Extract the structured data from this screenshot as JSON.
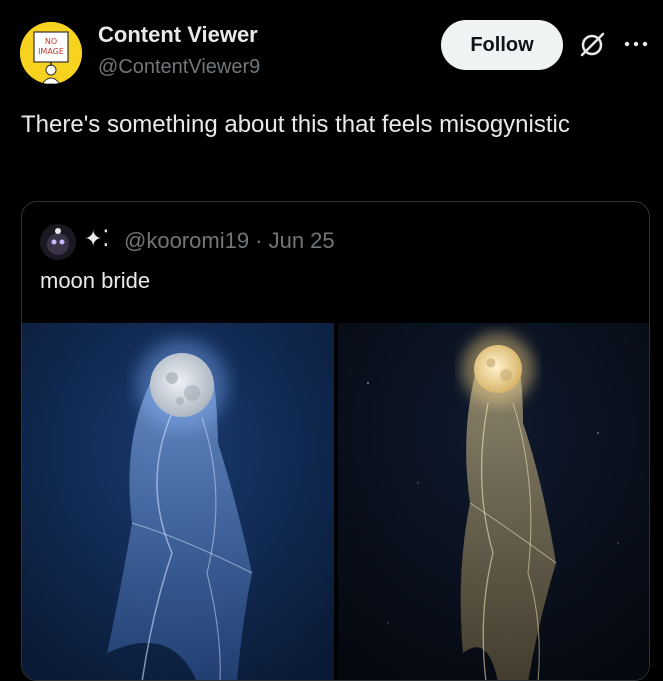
{
  "post": {
    "author": {
      "name": "Content Viewer",
      "handle": "@ContentViewer9"
    },
    "avatar": {
      "sign_line1": "NO",
      "sign_line2": "IMAGE",
      "bg_color": "#f7d21e"
    },
    "follow_label": "Follow",
    "text": "There's something about this that feels misogynistic"
  },
  "quoted_post": {
    "sparkle": "✦⁚",
    "handle_line": "@kooromi19 · Jun 25",
    "text": "moon bride",
    "images": [
      {
        "description": "moon with blue veil",
        "tone": "#4a7bd0"
      },
      {
        "description": "moon with golden veil",
        "tone": "#d8c28a"
      }
    ]
  },
  "icons": {
    "grok": "grok-icon",
    "more": "more-options-icon"
  },
  "colors": {
    "background": "#000000",
    "text": "#e7e9ea",
    "muted": "#71767b",
    "border": "#2f3336"
  }
}
